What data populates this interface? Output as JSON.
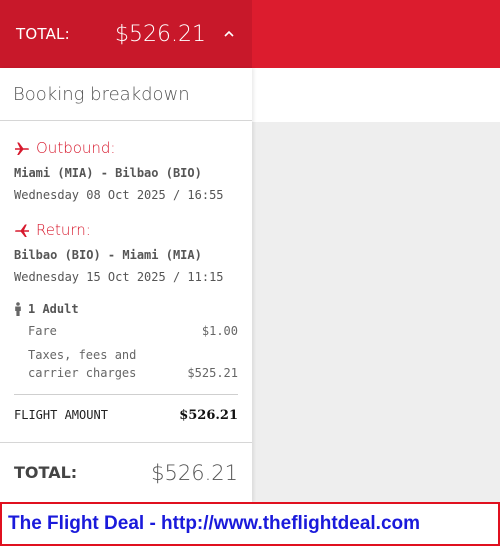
{
  "header": {
    "total_label": "TOTAL:",
    "total_amount": "$526.21",
    "toggle_icon": "chevron-up-icon"
  },
  "breakdown": {
    "title": "Booking breakdown",
    "outbound": {
      "label": "Outbound:",
      "route": "Miami (MIA) - Bilbao (BIO)",
      "datetime": "Wednesday 08 Oct 2025 / 16:55"
    },
    "return": {
      "label": "Return:",
      "route": "Bilbao (BIO) - Miami (MIA)",
      "datetime": "Wednesday 15 Oct 2025 / 11:15"
    },
    "passengers": {
      "label": "1 Adult",
      "fare_label": "Fare",
      "fare_value": "$1.00",
      "taxes_label": "Taxes, fees and carrier charges",
      "taxes_value": "$525.21"
    },
    "flight_amount_label": "FLIGHT AMOUNT",
    "flight_amount_value": "$526.21",
    "total_label": "TOTAL:",
    "total_value": "$526.21"
  },
  "banner": {
    "text": "The Flight Deal - http://www.theflightdeal.com"
  },
  "colors": {
    "brand_red": "#dc1c2e",
    "header_red": "#c8182a",
    "banner_blue": "#1a1adb"
  }
}
